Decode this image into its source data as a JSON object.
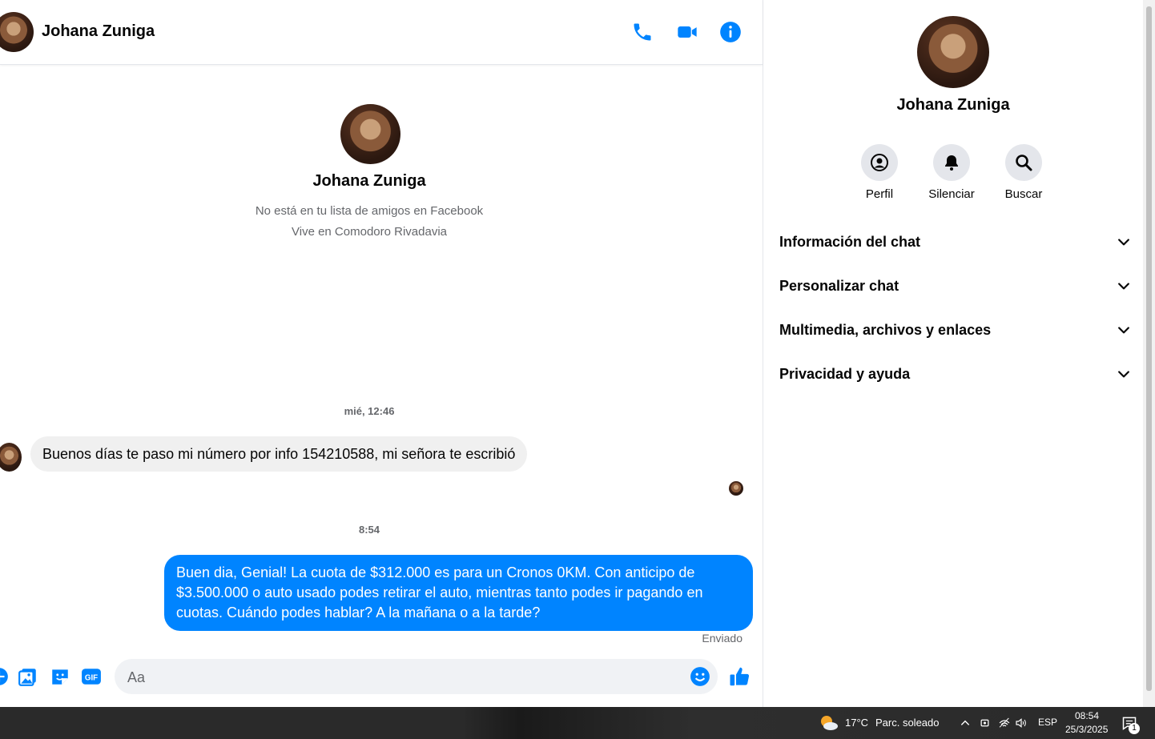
{
  "header": {
    "name": "Johana Zuniga"
  },
  "profile": {
    "name": "Johana Zuniga",
    "line1": "No está en tu lista de amigos en Facebook",
    "line2": "Vive en Comodoro Rivadavia"
  },
  "messages": {
    "ts1": "mié, 12:46",
    "incoming": "Buenos días te paso mi número por info 154210588, mi señora te escribió",
    "ts2": "8:54",
    "outgoing": "Buen dia, Genial! La cuota de $312.000 es para un Cronos 0KM. Con anticipo de $3.500.000 o auto usado podes retirar el auto, mientras tanto podes ir pagando en cuotas. Cuándo podes hablar? A la mañana o a la tarde?",
    "status": "Enviado"
  },
  "composer": {
    "placeholder": "Aa"
  },
  "sidebar": {
    "name": "Johana Zuniga",
    "actions": [
      {
        "label": "Perfil",
        "icon": "profile-icon"
      },
      {
        "label": "Silenciar",
        "icon": "bell-icon"
      },
      {
        "label": "Buscar",
        "icon": "search-icon"
      }
    ],
    "sections": [
      {
        "label": "Información del chat"
      },
      {
        "label": "Personalizar chat"
      },
      {
        "label": "Multimedia, archivos y enlaces"
      },
      {
        "label": "Privacidad y ayuda"
      }
    ]
  },
  "taskbar": {
    "temp": "17°C",
    "weather": "Parc. soleado",
    "lang": "ESP",
    "time": "08:54",
    "date": "25/3/2025",
    "notif_count": "1"
  },
  "colors": {
    "accent": "#0084ff",
    "bubble_in": "#f0f0f0"
  }
}
